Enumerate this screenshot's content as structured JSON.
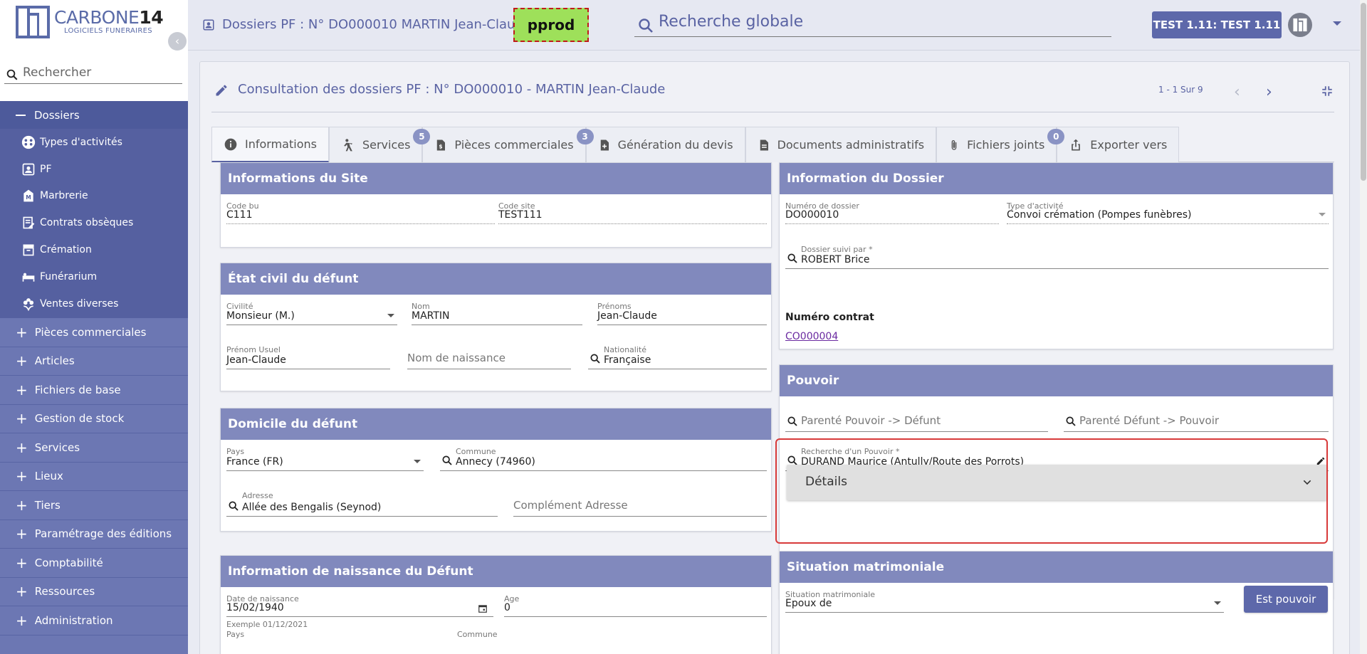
{
  "brand": {
    "name_light": "CARBONE",
    "name_bold": "14",
    "tagline": "LOGICIELS FUNERAIRES"
  },
  "sidebar": {
    "search_placeholder": "Rechercher",
    "section": "Dossiers",
    "sub_items": [
      {
        "label": "Types d'activités",
        "icon": "activities-icon"
      },
      {
        "label": "PF",
        "icon": "contact-card-icon"
      },
      {
        "label": "Marbrerie",
        "icon": "marbrerie-icon"
      },
      {
        "label": "Contrats obsèques",
        "icon": "contract-sign-icon"
      },
      {
        "label": "Crémation",
        "icon": "archive-box-icon"
      },
      {
        "label": "Funérarium",
        "icon": "bed-icon"
      },
      {
        "label": "Ventes diverses",
        "icon": "flower-icon"
      }
    ],
    "items": [
      "Pièces commerciales",
      "Articles",
      "Fichiers de base",
      "Gestion de stock",
      "Services",
      "Lieux",
      "Tiers",
      "Paramétrage des éditions",
      "Comptabilité",
      "Ressources",
      "Administration"
    ]
  },
  "topbar": {
    "breadcrumb": "Dossiers PF : N° DO000010 MARTIN Jean-Claude",
    "env_badge": "pprod",
    "global_search_placeholder": "Recherche globale",
    "user_label": "TEST 1.11: TEST 1.11"
  },
  "page": {
    "title": "Consultation des dossiers PF : N° DO000010 - MARTIN Jean-Claude",
    "pager": "1 - 1 Sur 9"
  },
  "tabs": [
    {
      "label": "Informations",
      "badge": ""
    },
    {
      "label": "Services",
      "badge": "5"
    },
    {
      "label": "Pièces commerciales",
      "badge": "3"
    },
    {
      "label": "Génération du devis",
      "badge": ""
    },
    {
      "label": "Documents administratifs",
      "badge": ""
    },
    {
      "label": "Fichiers joints",
      "badge": "0"
    },
    {
      "label": "Exporter vers",
      "badge": ""
    }
  ],
  "site": {
    "title": "Informations du Site",
    "code_bu_label": "Code bu",
    "code_bu": "C111",
    "code_site_label": "Code site",
    "code_site": "TEST111"
  },
  "etat_civil": {
    "title": "État civil du défunt",
    "civilite_label": "Civilité",
    "civilite": "Monsieur (M.)",
    "nom_label": "Nom",
    "nom": "MARTIN",
    "prenoms_label": "Prénoms",
    "prenoms": "Jean-Claude",
    "prenom_usuel_label": "Prénom Usuel",
    "prenom_usuel": "Jean-Claude",
    "nom_naissance_placeholder": "Nom de naissance",
    "nationalite_label": "Nationalité",
    "nationalite": "Française"
  },
  "domicile": {
    "title": "Domicile du défunt",
    "pays_label": "Pays",
    "pays": "France (FR)",
    "commune_label": "Commune",
    "commune": "Annecy (74960)",
    "adresse_label": "Adresse",
    "adresse": "Allée des Bengalis (Seynod)",
    "complement_placeholder": "Complément Adresse"
  },
  "naissance": {
    "title": "Information de naissance du Défunt",
    "date_label": "Date de naissance",
    "date": "15/02/1940",
    "age_label": "Age",
    "age": "0",
    "hint": "Exemple 01/12/2021",
    "pays_label": "Pays",
    "commune_label": "Commune"
  },
  "dossier": {
    "title": "Information du Dossier",
    "numero_label": "Numéro de dossier",
    "numero": "DO000010",
    "type_label": "Type d'activité",
    "type": "Convoi crémation (Pompes funèbres)",
    "suivi_label": "Dossier suivi par *",
    "suivi": "ROBERT Brice",
    "contrat_label": "Numéro contrat",
    "contrat": "CO000004"
  },
  "pouvoir": {
    "title": "Pouvoir",
    "parente1_placeholder": "Parenté Pouvoir -> Défunt",
    "parente2_placeholder": "Parenté Défunt -> Pouvoir",
    "recherche_label": "Recherche d'un Pouvoir *",
    "recherche": "DURAND Maurice (Antully/Route des Porrots)",
    "details": "Détails"
  },
  "matrimoniale": {
    "title": "Situation matrimoniale",
    "situation_label": "Situation matrimoniale",
    "situation": "Epoux de",
    "button": "Est pouvoir"
  }
}
